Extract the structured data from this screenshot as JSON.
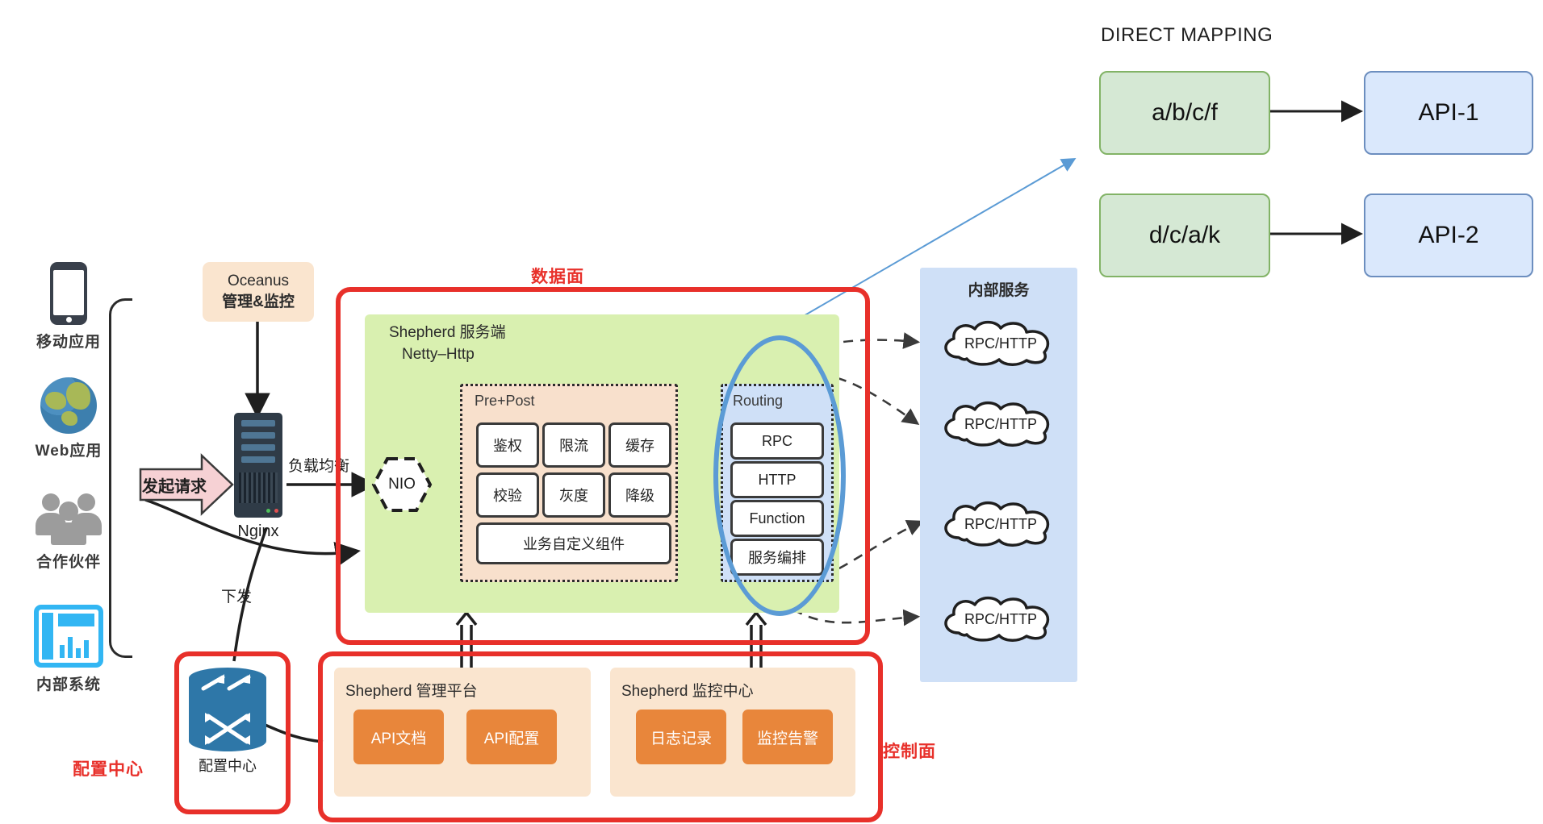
{
  "clients": {
    "items": [
      {
        "label": "移动应用",
        "icon": "mobile-phone-icon"
      },
      {
        "label": "Web应用",
        "icon": "globe-icon"
      },
      {
        "label": "合作伙伴",
        "icon": "people-group-icon"
      },
      {
        "label": "内部系统",
        "icon": "internal-system-icon"
      }
    ]
  },
  "request_arrow": {
    "label": "发起请求"
  },
  "oceanus": {
    "line1": "Oceanus",
    "line2": "管理&监控"
  },
  "nginx": {
    "label": "Nginx"
  },
  "load_balance": {
    "label": "负载均衡"
  },
  "dispatch": {
    "label": "下发"
  },
  "data_plane": {
    "label": "数据面",
    "panel_title_line1": "Shepherd 服务端",
    "panel_title_line2": "Netty–Http",
    "nio": {
      "label": "NIO"
    },
    "pre_post": {
      "title": "Pre+Post",
      "chips": [
        "鉴权",
        "限流",
        "缓存",
        "校验",
        "灰度",
        "降级"
      ],
      "wide_chip": "业务自定义组件"
    },
    "routing": {
      "title": "Routing",
      "chips": [
        "RPC",
        "HTTP",
        "Function",
        "服务编排"
      ]
    }
  },
  "internal_services": {
    "title": "内部服务",
    "clouds": [
      "RPC/HTTP",
      "RPC/HTTP",
      "RPC/HTTP",
      "RPC/HTTP"
    ]
  },
  "config_center": {
    "red_label": "配置中心",
    "node_label": "配置中心"
  },
  "control_plane": {
    "label": "控制面",
    "cards": [
      {
        "title": "Shepherd 管理平台",
        "buttons": [
          "API文档",
          "API配置"
        ]
      },
      {
        "title": "Shepherd 监控中心",
        "buttons": [
          "日志记录",
          "监控告警"
        ]
      }
    ]
  },
  "direct_mapping": {
    "title": "DIRECT MAPPING",
    "rows": [
      {
        "path": "a/b/c/f",
        "api": "API-1"
      },
      {
        "path": "d/c/a/k",
        "api": "API-2"
      }
    ]
  },
  "colors": {
    "red": "#e8302a",
    "green_panel": "#d9f0b0",
    "orange_btn": "#e8863b",
    "blue_panel": "#cfe0f7",
    "ellipse_blue": "#5b9bd5",
    "map_green": "#d5e8d4",
    "map_blue": "#dae8fc"
  }
}
